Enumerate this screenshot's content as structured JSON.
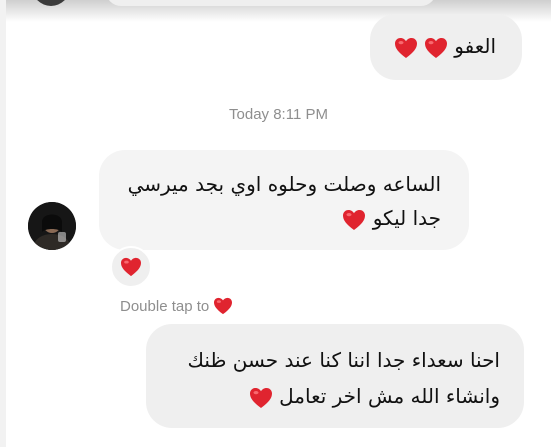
{
  "chat": {
    "sent_message_1": "العفو",
    "timestamp": "Today 8:11 PM",
    "received_message": {
      "line1": "الساعه وصلت وحلوه اوي بجد ميرسي",
      "line2": "جدا ليكو"
    },
    "double_tap_hint": "Double tap to",
    "sent_message_2": {
      "line1": "احنا سعداء جدا اننا كنا عند حسن ظنك",
      "line2": "وانشاء الله مش اخر تعامل"
    }
  },
  "icons": {
    "heart": "heart-icon",
    "avatar": "contact-avatar"
  },
  "colors": {
    "heart": "#e0242f",
    "bubble": "#efefef",
    "timestamp": "#8e8e8e"
  }
}
